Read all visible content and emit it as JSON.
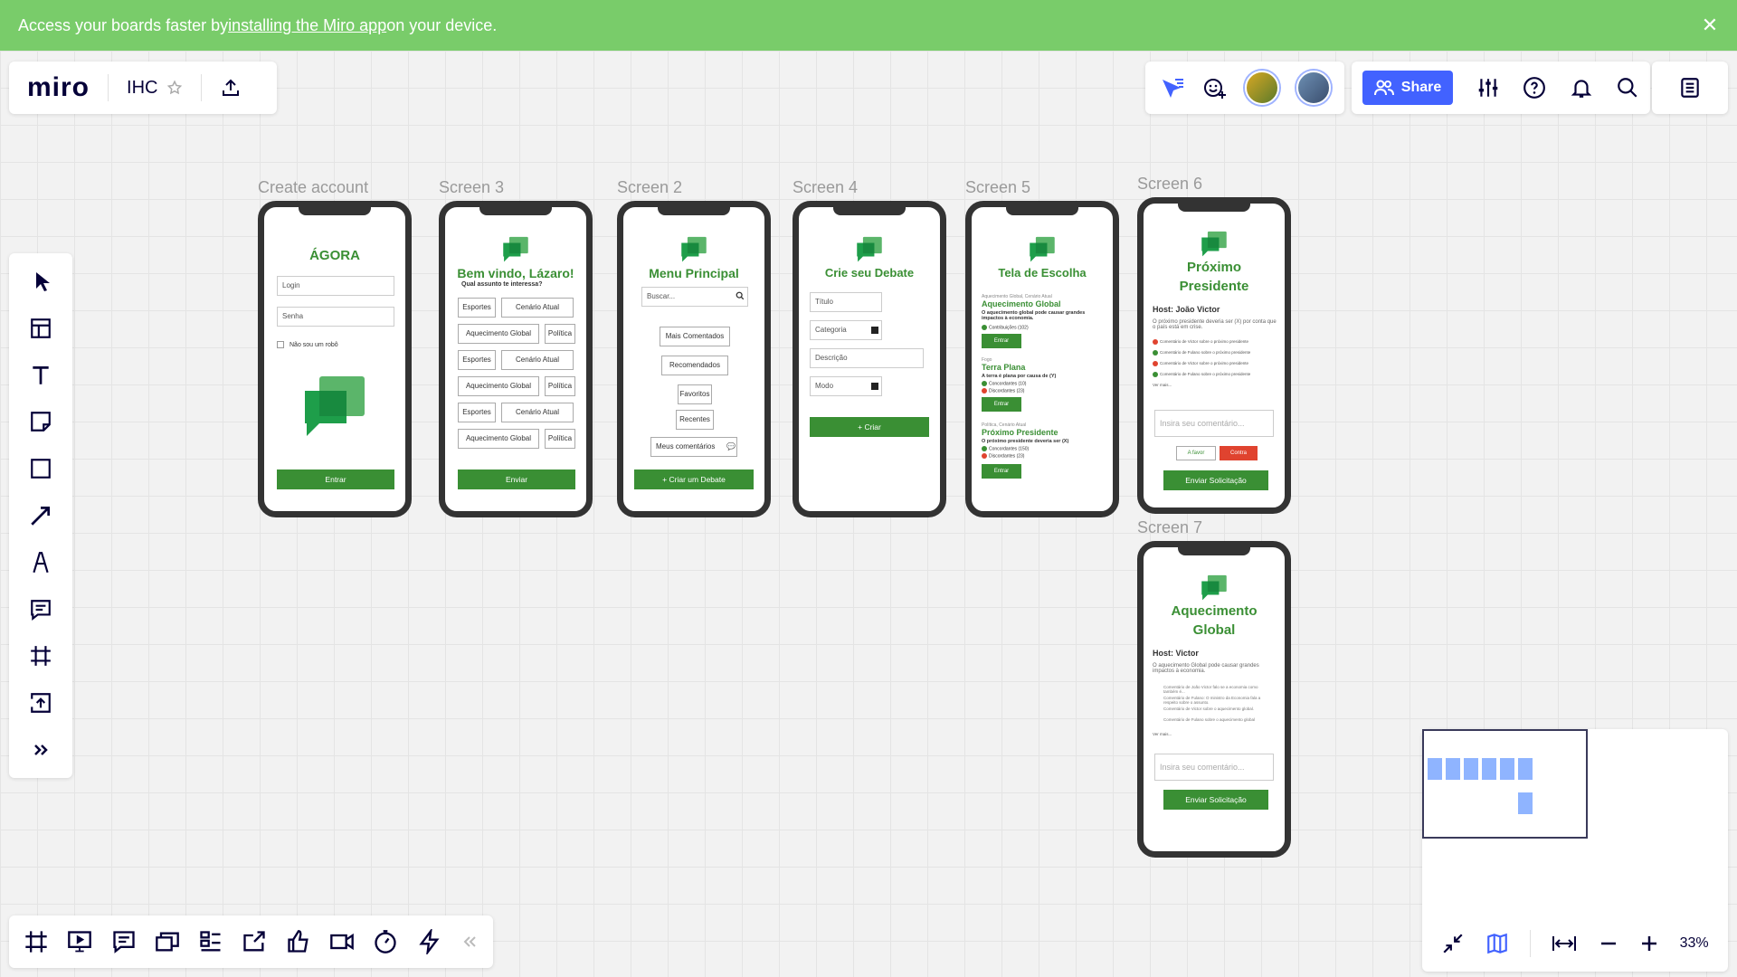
{
  "banner": {
    "text_pre": "Access your boards faster by ",
    "link": "installing the Miro app",
    "text_post": " on your device.",
    "close": "✕"
  },
  "topbar": {
    "logo": "miro",
    "board_name": "IHC",
    "share_label": "Share",
    "zoom": "33%"
  },
  "frames": [
    {
      "label": "Create account",
      "title": "ÁGORA",
      "login_ph": "Login",
      "senha_ph": "Senha",
      "robot": "Não sou um robô",
      "button": "Entrar"
    },
    {
      "label": "Screen 3",
      "title": "Bem vindo, Lázaro!",
      "subtitle": "Qual assunto te interessa?",
      "tags": [
        "Esportes",
        "Cenário Atual",
        "Aquecimento Global",
        "Política",
        "Esportes",
        "Cenário Atual",
        "Aquecimento Global",
        "Política",
        "Esportes",
        "Cenário Atual",
        "Aquecimento Global",
        "Política"
      ],
      "button": "Enviar"
    },
    {
      "label": "Screen 2",
      "title": "Menu Principal",
      "search_ph": "Buscar...",
      "items": [
        "Mais Comentados",
        "Recomendados",
        "Favoritos",
        "Recentes",
        "Meus comentários"
      ],
      "button": "+ Criar um Debate"
    },
    {
      "label": "Screen 4",
      "title": "Crie seu Debate",
      "fields": [
        "Título",
        "Categoria",
        "Descrição",
        "Modo"
      ],
      "button": "+ Criar"
    },
    {
      "label": "Screen 5",
      "title": "Tela de Escolha",
      "topics": [
        {
          "cat": "Aquecimento Global, Cenário Atual",
          "name": "Aquecimento Global",
          "desc": "O aquecimento global pode causar grandes impactos à economia.",
          "c1": "Contribuições (102)",
          "btn": "Entrar"
        },
        {
          "cat": "Fogo",
          "name": "Terra Plana",
          "desc": "A terra é plana por causa de (Y)",
          "c1": "Concordantes (10)",
          "c2": "Discordantes (23)",
          "btn": "Entrar"
        },
        {
          "cat": "Política, Cenário Atual",
          "name": "Próximo Presidente",
          "desc": "O próximo presidente deveria ser (X)",
          "c1": "Concordantes (150)",
          "c2": "Discordantes (23)",
          "btn": "Entrar"
        }
      ]
    },
    {
      "label": "Screen 6",
      "title": "Próximo Presidente",
      "host": "Host: João Victor",
      "desc": "O próximo presidente deveria ser (X) por conta que o país está em crise.",
      "comments": [
        "Comentário de Victor sobre o próximo presidente",
        "Comentário de Fulano sobre o próximo presidente",
        "Comentário de Victor sobre o próximo presidente",
        "Comentário de Fulano sobre o próximo presidente"
      ],
      "more": "Ver mais...",
      "comment_ph": "Insira seu comentário...",
      "favor": "A favor",
      "contra": "Contra",
      "button": "Enviar Solicitação"
    },
    {
      "label": "Screen 7",
      "title": "Aquecimento Global",
      "host": "Host: Victor",
      "desc": "O aquecimento Global pode causar grandes impactos à economia.",
      "comments": [
        "Comentário de João Victor falo se a economia como também é...",
        "Comentário de Fulano: O ministro da Economia fala a respeito sobre o assunto.",
        "Comentário de Victor sobre o aquecimento global.",
        "Comentário de Fulano sobre o aquecimento global"
      ],
      "more": "Ver mais...",
      "comment_ph": "Insira seu comentário...",
      "button": "Enviar Solicitação"
    }
  ]
}
